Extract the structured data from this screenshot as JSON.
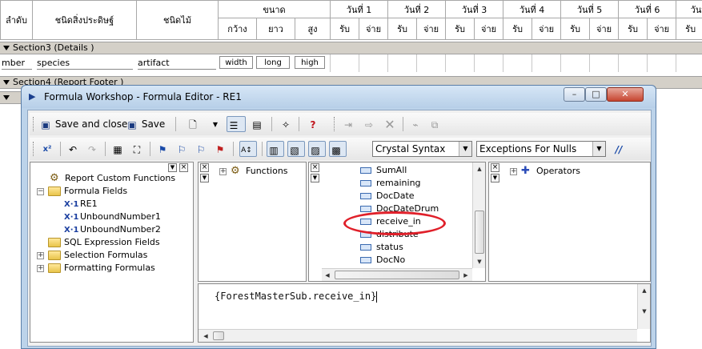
{
  "report": {
    "headers": {
      "col1": "ลำดับ",
      "col2": "ชนิดสิ่งประดิษฐ์",
      "col3": "ชนิดไม้",
      "size": "ขนาด",
      "width": "กว้าง",
      "length": "ยาว",
      "height": "สูง",
      "days": [
        "วันที่ 1",
        "วันที่ 2",
        "วันที่ 3",
        "วันที่ 4",
        "วันที่ 5",
        "วันที่ 6",
        "วันที่"
      ],
      "receive": "รับ",
      "pay": "จ่าย"
    },
    "section3": "Section3 (Details  )",
    "section4": "Section4 (Report Footer  )",
    "fields": {
      "number": "mber",
      "species": "species",
      "artifact": "artifact",
      "width": "width",
      "long": "long",
      "high": "high"
    }
  },
  "window": {
    "title": "Formula Workshop - Formula Editor - RE1",
    "minimize": "–",
    "maximize": "□",
    "close": "✕"
  },
  "toolbar": {
    "save_close": "Save and close",
    "save": "Save",
    "syntax": "Crystal Syntax",
    "nulls": "Exceptions For Nulls"
  },
  "tree": {
    "report_custom_functions": "Report Custom Functions",
    "formula_fields": "Formula Fields",
    "re1": "RE1",
    "unbound1": "UnboundNumber1",
    "unbound2": "UnboundNumber2",
    "sql_expression": "SQL Expression Fields",
    "selection": "Selection Formulas",
    "formatting": "Formatting Formulas"
  },
  "functions_pane": {
    "root": "Functions"
  },
  "fields_pane": {
    "items": [
      "SumAll",
      "remaining",
      "DocDate",
      "DocDateDrum",
      "receive_in",
      "distribute",
      "status",
      "DocNo"
    ]
  },
  "operators_pane": {
    "root": "Operators"
  },
  "editor": {
    "text": "{ForestMasterSub.receive_in}"
  },
  "colors": {
    "highlight": "#e0202a",
    "title_bar": "#bcd3ea",
    "close_button": "#c6442f"
  }
}
